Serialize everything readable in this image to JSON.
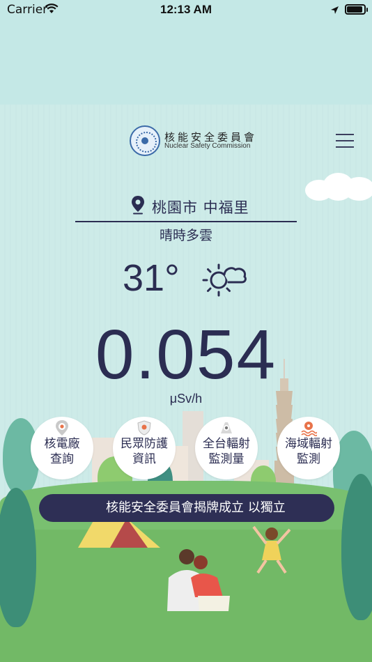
{
  "status_bar": {
    "carrier": "Carrier",
    "time": "12:13 AM",
    "battery_level": 0.9
  },
  "header": {
    "org_name_zh": "核能安全委員會",
    "org_name_en": "Nuclear Safety Commission"
  },
  "location": {
    "name": "桃園市 中福里",
    "weather_description": "晴時多雲",
    "temperature": "31°",
    "weather_icon": "sun-cloud-icon"
  },
  "radiation": {
    "value": "0.054",
    "unit": "μSv/h"
  },
  "quick_links": [
    {
      "label_line1": "核電廠",
      "label_line2": "查詢",
      "icon": "radiation-pin-icon"
    },
    {
      "label_line1": "民眾防護",
      "label_line2": "資訊",
      "icon": "radiation-shield-icon"
    },
    {
      "label_line1": "全台輻射",
      "label_line2": "監測量",
      "icon": "radiation-monitor-icon"
    },
    {
      "label_line1": "海域輻射",
      "label_line2": "監測",
      "icon": "sea-radiation-icon"
    }
  ],
  "banner": {
    "text": "核能安全委員會揭牌成立 以獨立"
  },
  "colors": {
    "primary": "#2b2d52",
    "sky": "#cdebe8",
    "grass": "#79c070",
    "banner_bg": "#2e2f55",
    "radiation_accent": "#e8734a"
  }
}
